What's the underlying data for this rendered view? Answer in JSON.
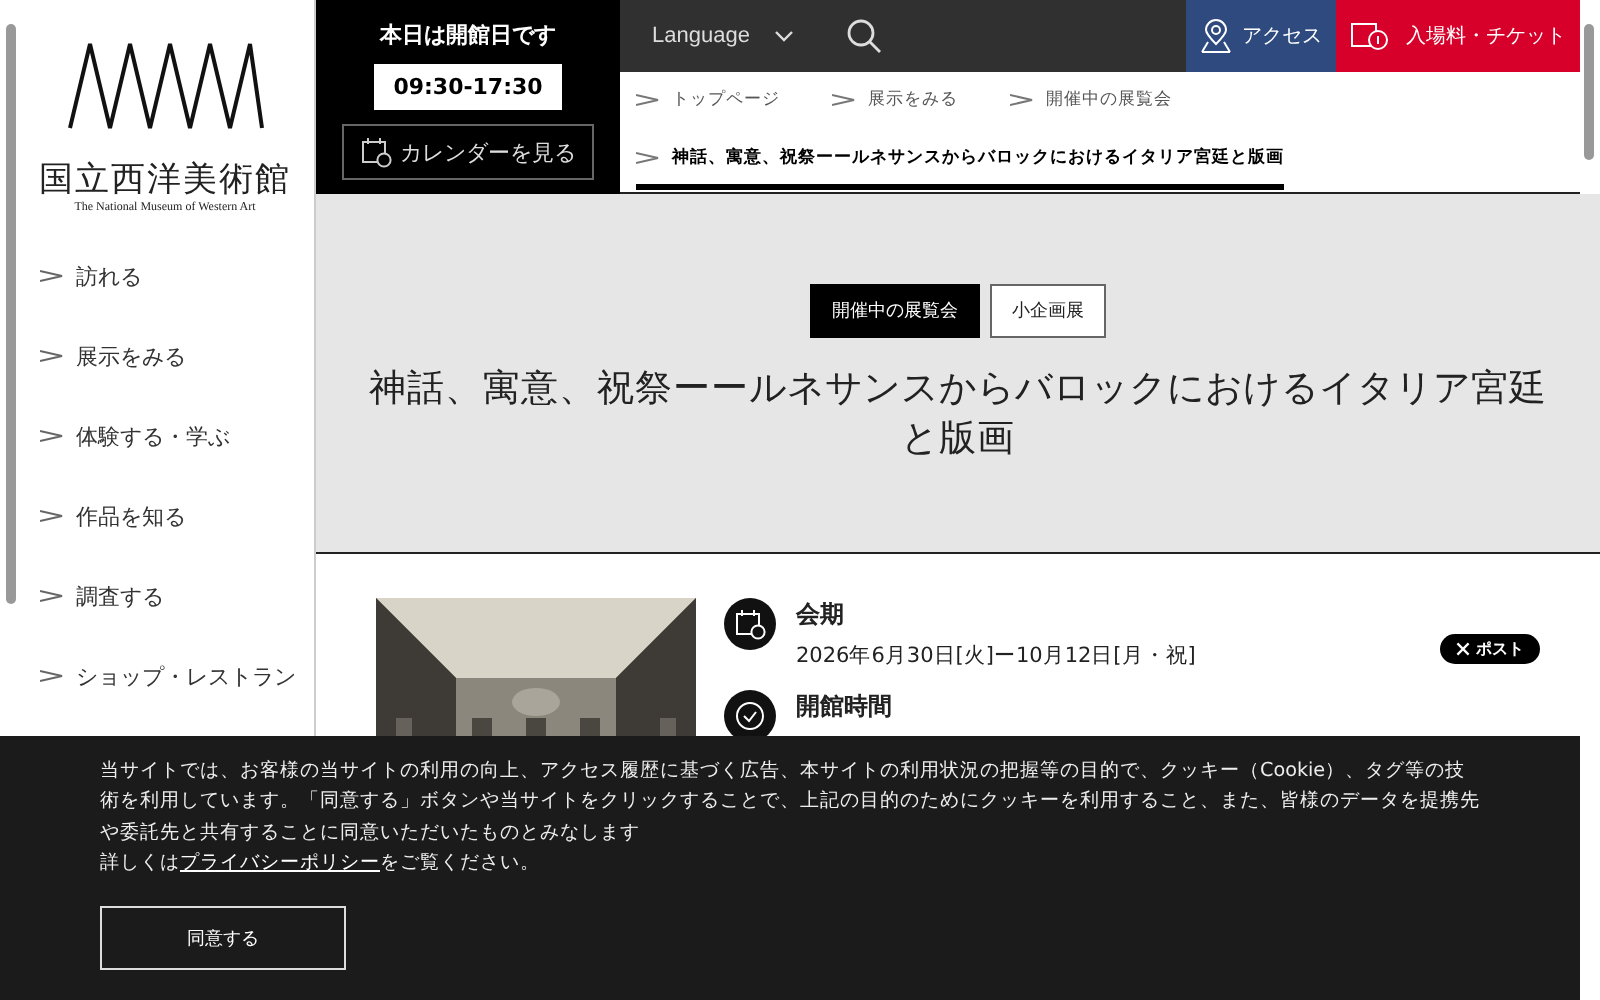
{
  "logo": {
    "name": "国立西洋美術館",
    "subtitle": "The National Museum of Western Art"
  },
  "today": {
    "status": "本日は開館日です",
    "hours": "09:30-17:30",
    "calendar_button": "カレンダーを見る"
  },
  "topbar": {
    "language": "Language",
    "access": "アクセス",
    "tickets": "入場料・チケット"
  },
  "breadcrumbs": [
    {
      "label": "トップページ",
      "selected": false
    },
    {
      "label": "展示をみる",
      "selected": false
    },
    {
      "label": "開催中の展覧会",
      "selected": false
    },
    {
      "label": "神話、寓意、祝祭ーールネサンスからバロックにおけるイタリア宮廷と版画",
      "selected": true
    }
  ],
  "sidebar": {
    "items": [
      {
        "label": "訪れる"
      },
      {
        "label": "展示をみる"
      },
      {
        "label": "体験する・学ぶ"
      },
      {
        "label": "作品を知る"
      },
      {
        "label": "調査する"
      },
      {
        "label": "ショップ・レストラン"
      }
    ]
  },
  "exhibition": {
    "tags": [
      {
        "label": "開催中の展覧会",
        "kind": "status"
      },
      {
        "label": "小企画展",
        "kind": "category"
      }
    ],
    "title": "神話、寓意、祝祭ーールネサンスからバロックにおけるイタリア宮廷と版画",
    "info": [
      {
        "kind": "calendar",
        "heading": "会期",
        "text": "2026年6月30日[火]ー10月12日[月・祝]"
      },
      {
        "kind": "clock",
        "heading": "開館時間"
      }
    ],
    "share": "ポスト"
  },
  "cookie": {
    "notice": "当サイトでは、お客様の当サイトの利用の向上、アクセス履歴に基づく広告、本サイトの利用状況の把握等の目的で、クッキー（Cookie）、タグ等の技術を利用しています。「同意する」ボタンや当サイトをクリックすることで、上記の目的のためにクッキーを利用すること、また、皆様のデータを提携先や委託先と共有することに同意いただいたものとみなします",
    "details_before": "詳しくは",
    "privacy_link": "プライバシーポリシー",
    "details_after": "をご覧ください。",
    "agree_button": "同意する"
  }
}
